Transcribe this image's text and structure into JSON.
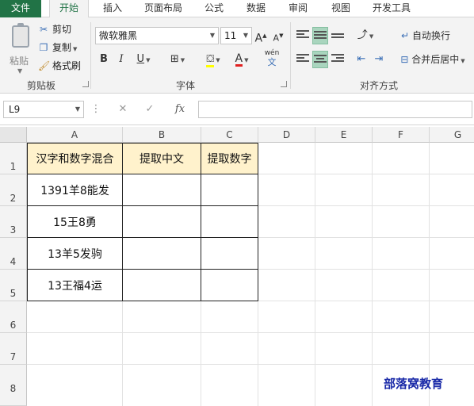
{
  "tabs": [
    "文件",
    "开始",
    "插入",
    "页面布局",
    "公式",
    "数据",
    "审阅",
    "视图",
    "开发工具"
  ],
  "clipboard": {
    "paste": "粘贴",
    "cut": "剪切",
    "copy": "复制",
    "format_painter": "格式刷",
    "group": "剪贴板"
  },
  "font": {
    "name": "微软雅黑",
    "size": "11",
    "grow": "A",
    "shrink": "A",
    "bold": "B",
    "italic": "I",
    "underline": "U",
    "fill_letter": "A",
    "wen": "wén",
    "wen_char": "文",
    "group": "字体"
  },
  "align": {
    "wrap_text": "自动换行",
    "merge_center": "合并后居中",
    "group": "对齐方式"
  },
  "formula_bar": {
    "name_box": "L9",
    "cancel": "✕",
    "enter": "✓",
    "fx": "fx",
    "value": ""
  },
  "columns": [
    "A",
    "B",
    "C",
    "D",
    "E",
    "F",
    "G"
  ],
  "rows": [
    "1",
    "2",
    "3",
    "4",
    "5",
    "6",
    "7",
    "8"
  ],
  "table": {
    "headers": [
      "汉字和数字混合",
      "提取中文",
      "提取数字"
    ],
    "rows": [
      [
        "1391羊8能发",
        "",
        ""
      ],
      [
        "15王8勇",
        "",
        ""
      ],
      [
        "13羊5发驹",
        "",
        ""
      ],
      [
        "13王福4运",
        "",
        ""
      ]
    ]
  },
  "watermark": "部落窝教育",
  "colors": {
    "accent": "#217346",
    "header_fill": "#fff2cc",
    "selected_button": "#a9d5be",
    "watermark": "#1a2aa8",
    "font_color_bar": "#e02020",
    "highlight_bar": "#ffff00"
  }
}
